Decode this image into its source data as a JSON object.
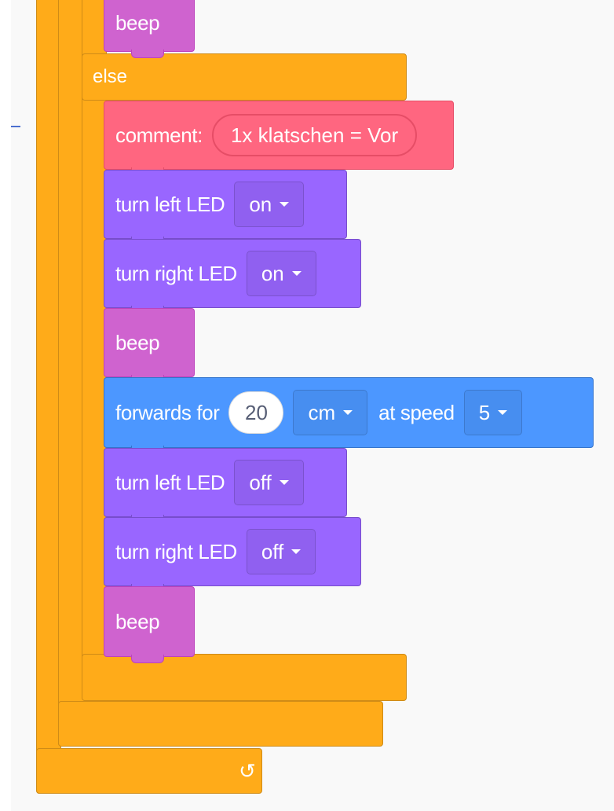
{
  "workspace": {
    "else_label": "else",
    "loop_arrow": "↺"
  },
  "blocks": {
    "beep_top": "beep",
    "comment": {
      "label": "comment:",
      "value": "1x klatschen = Vor"
    },
    "turn_left_on": {
      "label": "turn left LED",
      "value": "on"
    },
    "turn_right_on": {
      "label": "turn right LED",
      "value": "on"
    },
    "beep_mid": "beep",
    "forwards": {
      "label": "forwards for",
      "distance": "20",
      "unit": "cm",
      "speed_label": "at speed",
      "speed": "5"
    },
    "turn_left_off": {
      "label": "turn left LED",
      "value": "off"
    },
    "turn_right_off": {
      "label": "turn right LED",
      "value": "off"
    },
    "beep_bottom": "beep"
  },
  "colors": {
    "control": "#ffab19",
    "looks": "#9966ff",
    "sound": "#cf63cf",
    "comment": "#ff6680",
    "motion": "#4c97ff"
  }
}
